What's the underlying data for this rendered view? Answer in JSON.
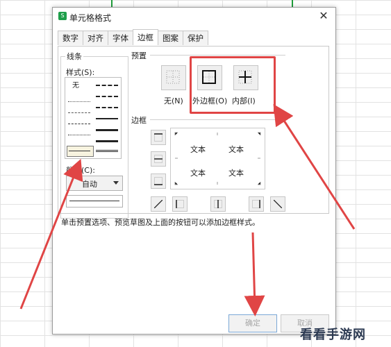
{
  "dialog": {
    "title": "单元格格式",
    "close_glyph": "✕",
    "app_icon": "S"
  },
  "tabs": [
    "数字",
    "对齐",
    "字体",
    "边框",
    "图案",
    "保护"
  ],
  "active_tab": "边框",
  "line_group": {
    "title": "线条",
    "style_label": "样式(S):",
    "none_label": "无",
    "color_label": "颜色(C):",
    "color_value": "自动"
  },
  "presets": {
    "title": "预置",
    "none": "无(N)",
    "outline": "外边框(O)",
    "inside": "内部(I)"
  },
  "border_section": {
    "title": "边框",
    "preview_text": [
      "文本",
      "文本",
      "文本",
      "文本"
    ]
  },
  "hint": "单击预置选项、预览草图及上面的按钮可以添加边框样式。",
  "buttons": {
    "ok": "确定",
    "cancel": "取消"
  },
  "watermark": "看看手游网",
  "colors": {
    "annotation": "#e04545",
    "selection": "#1f9d3b"
  }
}
